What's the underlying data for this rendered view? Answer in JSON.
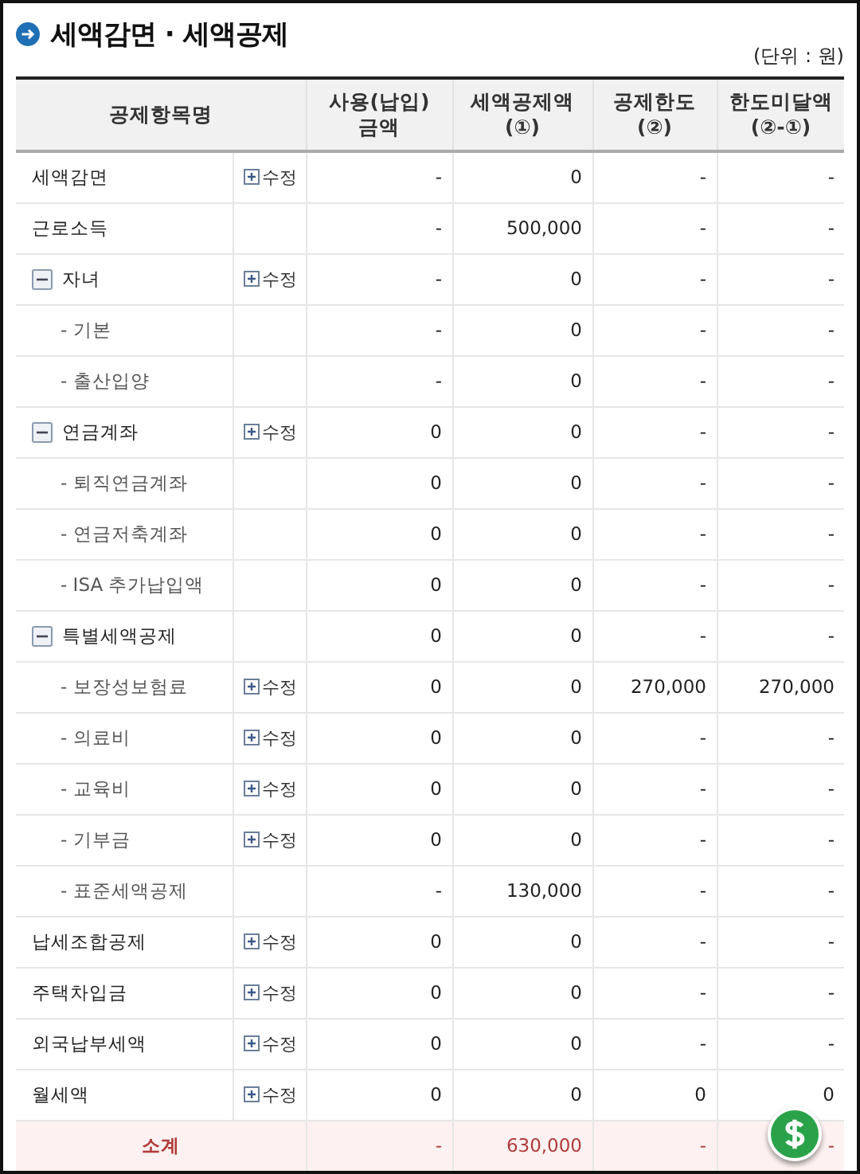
{
  "title": "세액감면 · 세액공제",
  "unit": "(단위 : 원)",
  "columns": [
    {
      "label": "공제항목명"
    },
    {
      "label": "사용(납입)\n금액"
    },
    {
      "label": "세액공제액\n(①)"
    },
    {
      "label": "공제한도\n(②)"
    },
    {
      "label": "한도미달액\n(②-①)"
    }
  ],
  "rows": [
    {
      "name": "세액감면",
      "edit": "수정",
      "values": [
        "-",
        "0",
        "-",
        "-"
      ]
    },
    {
      "name": "근로소득",
      "values": [
        "-",
        "500,000",
        "-",
        "-"
      ]
    },
    {
      "name": "자녀",
      "expanded": true,
      "edit": "수정",
      "values": [
        "-",
        "0",
        "-",
        "-"
      ],
      "children": [
        {
          "name": "- 기본",
          "values": [
            "-",
            "0",
            "-",
            "-"
          ]
        },
        {
          "name": "- 출산입양",
          "values": [
            "-",
            "0",
            "-",
            "-"
          ]
        }
      ]
    },
    {
      "name": "연금계좌",
      "expanded": true,
      "edit": "수정",
      "values": [
        "0",
        "0",
        "-",
        "-"
      ],
      "children": [
        {
          "name": "- 퇴직연금계좌",
          "values": [
            "0",
            "0",
            "-",
            "-"
          ]
        },
        {
          "name": "- 연금저축계좌",
          "values": [
            "0",
            "0",
            "-",
            "-"
          ]
        },
        {
          "name": "- ISA 추가납입액",
          "values": [
            "0",
            "0",
            "-",
            "-"
          ]
        }
      ]
    },
    {
      "name": "특별세액공제",
      "expanded": true,
      "values": [
        "0",
        "0",
        "-",
        "-"
      ],
      "children": [
        {
          "name": "- 보장성보험료",
          "edit": "수정",
          "values": [
            "0",
            "0",
            "270,000",
            "270,000"
          ]
        },
        {
          "name": "- 의료비",
          "edit": "수정",
          "values": [
            "0",
            "0",
            "-",
            "-"
          ]
        },
        {
          "name": "- 교육비",
          "edit": "수정",
          "values": [
            "0",
            "0",
            "-",
            "-"
          ]
        },
        {
          "name": "- 기부금",
          "edit": "수정",
          "values": [
            "0",
            "0",
            "-",
            "-"
          ]
        },
        {
          "name": "- 표준세액공제",
          "values": [
            "-",
            "130,000",
            "-",
            "-"
          ]
        }
      ]
    },
    {
      "name": "납세조합공제",
      "edit": "수정",
      "values": [
        "0",
        "0",
        "-",
        "-"
      ]
    },
    {
      "name": "주택차입금",
      "edit": "수정",
      "values": [
        "0",
        "0",
        "-",
        "-"
      ]
    },
    {
      "name": "외국납부세액",
      "edit": "수정",
      "values": [
        "0",
        "0",
        "-",
        "-"
      ]
    },
    {
      "name": "월세액",
      "edit": "수정",
      "values": [
        "0",
        "0",
        "0",
        "0"
      ]
    }
  ],
  "subtotal": {
    "label": "소계",
    "values": [
      "-",
      "630,000",
      "-",
      "-"
    ]
  }
}
